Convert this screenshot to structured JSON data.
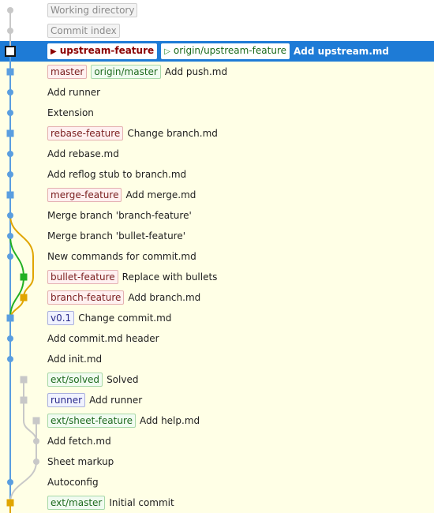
{
  "colors": {
    "branch_blue": "#5a9ee0",
    "branch_green": "#22b022",
    "branch_orange": "#e0a500",
    "branch_gray": "#c8c8c8",
    "selection": "#1e7bd6",
    "row_background": "#ffffe6"
  },
  "rows": [
    {
      "message": "",
      "refs": [
        {
          "label": "Working directory",
          "kind": "pseudo"
        }
      ]
    },
    {
      "message": "",
      "refs": [
        {
          "label": "Commit index",
          "kind": "pseudo"
        }
      ]
    },
    {
      "message": "Add upstream.md",
      "refs": [
        {
          "label": "upstream-feature",
          "kind": "head-local"
        },
        {
          "label": "origin/upstream-feature",
          "kind": "head-remote"
        }
      ]
    },
    {
      "message": "Add push.md",
      "refs": [
        {
          "label": "master",
          "kind": "local"
        },
        {
          "label": "origin/master",
          "kind": "remote"
        }
      ]
    },
    {
      "message": "Add runner",
      "refs": []
    },
    {
      "message": "Extension",
      "refs": []
    },
    {
      "message": "Change branch.md",
      "refs": [
        {
          "label": "rebase-feature",
          "kind": "local"
        }
      ]
    },
    {
      "message": "Add rebase.md",
      "refs": []
    },
    {
      "message": "Add reflog stub to branch.md",
      "refs": []
    },
    {
      "message": "Add merge.md",
      "refs": [
        {
          "label": "merge-feature",
          "kind": "local"
        }
      ]
    },
    {
      "message": "Merge branch 'branch-feature'",
      "refs": []
    },
    {
      "message": "Merge branch 'bullet-feature'",
      "refs": []
    },
    {
      "message": "New commands for commit.md",
      "refs": []
    },
    {
      "message": "Replace with bullets",
      "refs": [
        {
          "label": "bullet-feature",
          "kind": "local"
        }
      ]
    },
    {
      "message": "Add branch.md",
      "refs": [
        {
          "label": "branch-feature",
          "kind": "local"
        }
      ]
    },
    {
      "message": "Change commit.md",
      "refs": [
        {
          "label": "v0.1",
          "kind": "tagref"
        }
      ]
    },
    {
      "message": "Add commit.md header",
      "refs": []
    },
    {
      "message": "Add init.md",
      "refs": []
    },
    {
      "message": "Solved",
      "refs": [
        {
          "label": "ext/solved",
          "kind": "remote"
        }
      ]
    },
    {
      "message": "Add runner",
      "refs": [
        {
          "label": "runner",
          "kind": "tagref"
        }
      ]
    },
    {
      "message": "Add help.md",
      "refs": [
        {
          "label": "ext/sheet-feature",
          "kind": "remote"
        }
      ]
    },
    {
      "message": "Add fetch.md",
      "refs": []
    },
    {
      "message": "Sheet markup",
      "refs": []
    },
    {
      "message": "Autoconfig",
      "refs": []
    },
    {
      "message": "Initial commit",
      "refs": [
        {
          "label": "ext/master",
          "kind": "remote"
        }
      ]
    }
  ]
}
